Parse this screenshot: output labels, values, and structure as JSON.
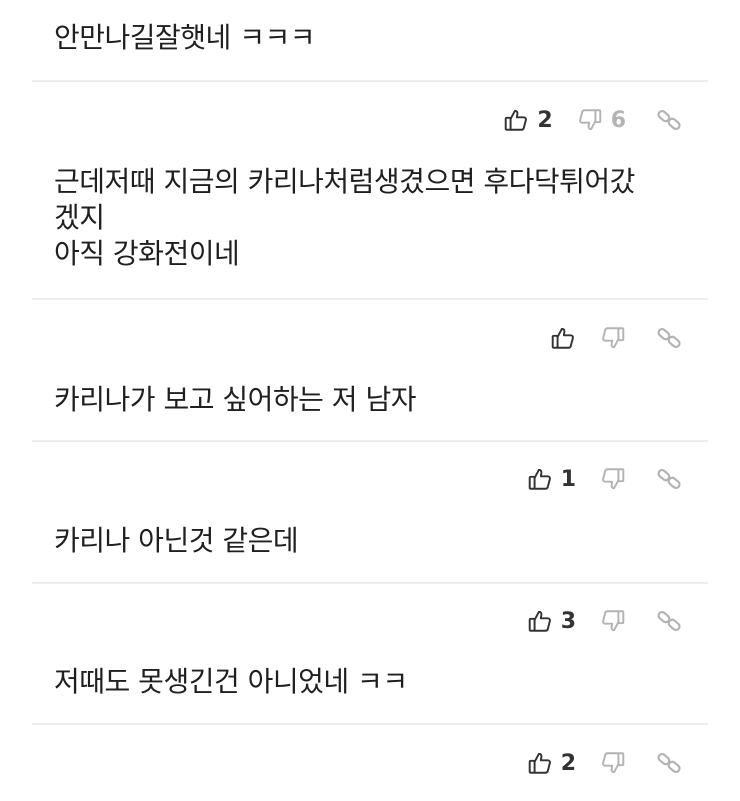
{
  "colors": {
    "text": "#1f1f1f",
    "like": "#333333",
    "dislike": "#b3b3b3",
    "link": "#b3b3b3",
    "divider": "#ececec"
  },
  "icons": {
    "like": "thumbs-up-icon",
    "dislike": "thumbs-down-icon",
    "link": "link-icon"
  },
  "comments": [
    {
      "text": "안만나길잘햇네 ㅋㅋㅋ",
      "likes": "",
      "dislikes": ""
    },
    {
      "text": "근데저때 지금의 카리나처럼생겼으면 후다닥튀어갔\n겠지\n아직 강화전이네",
      "likes": "2",
      "dislikes": "6"
    },
    {
      "text": "카리나가 보고 싶어하는 저 남자",
      "likes": "",
      "dislikes": ""
    },
    {
      "text": "카리나 아닌것 같은데",
      "likes": "1",
      "dislikes": ""
    },
    {
      "text": "저때도 못생긴건 아니었네 ㅋㅋ",
      "likes": "3",
      "dislikes": ""
    }
  ],
  "trailing_actions": {
    "likes": "2",
    "dislikes": ""
  }
}
